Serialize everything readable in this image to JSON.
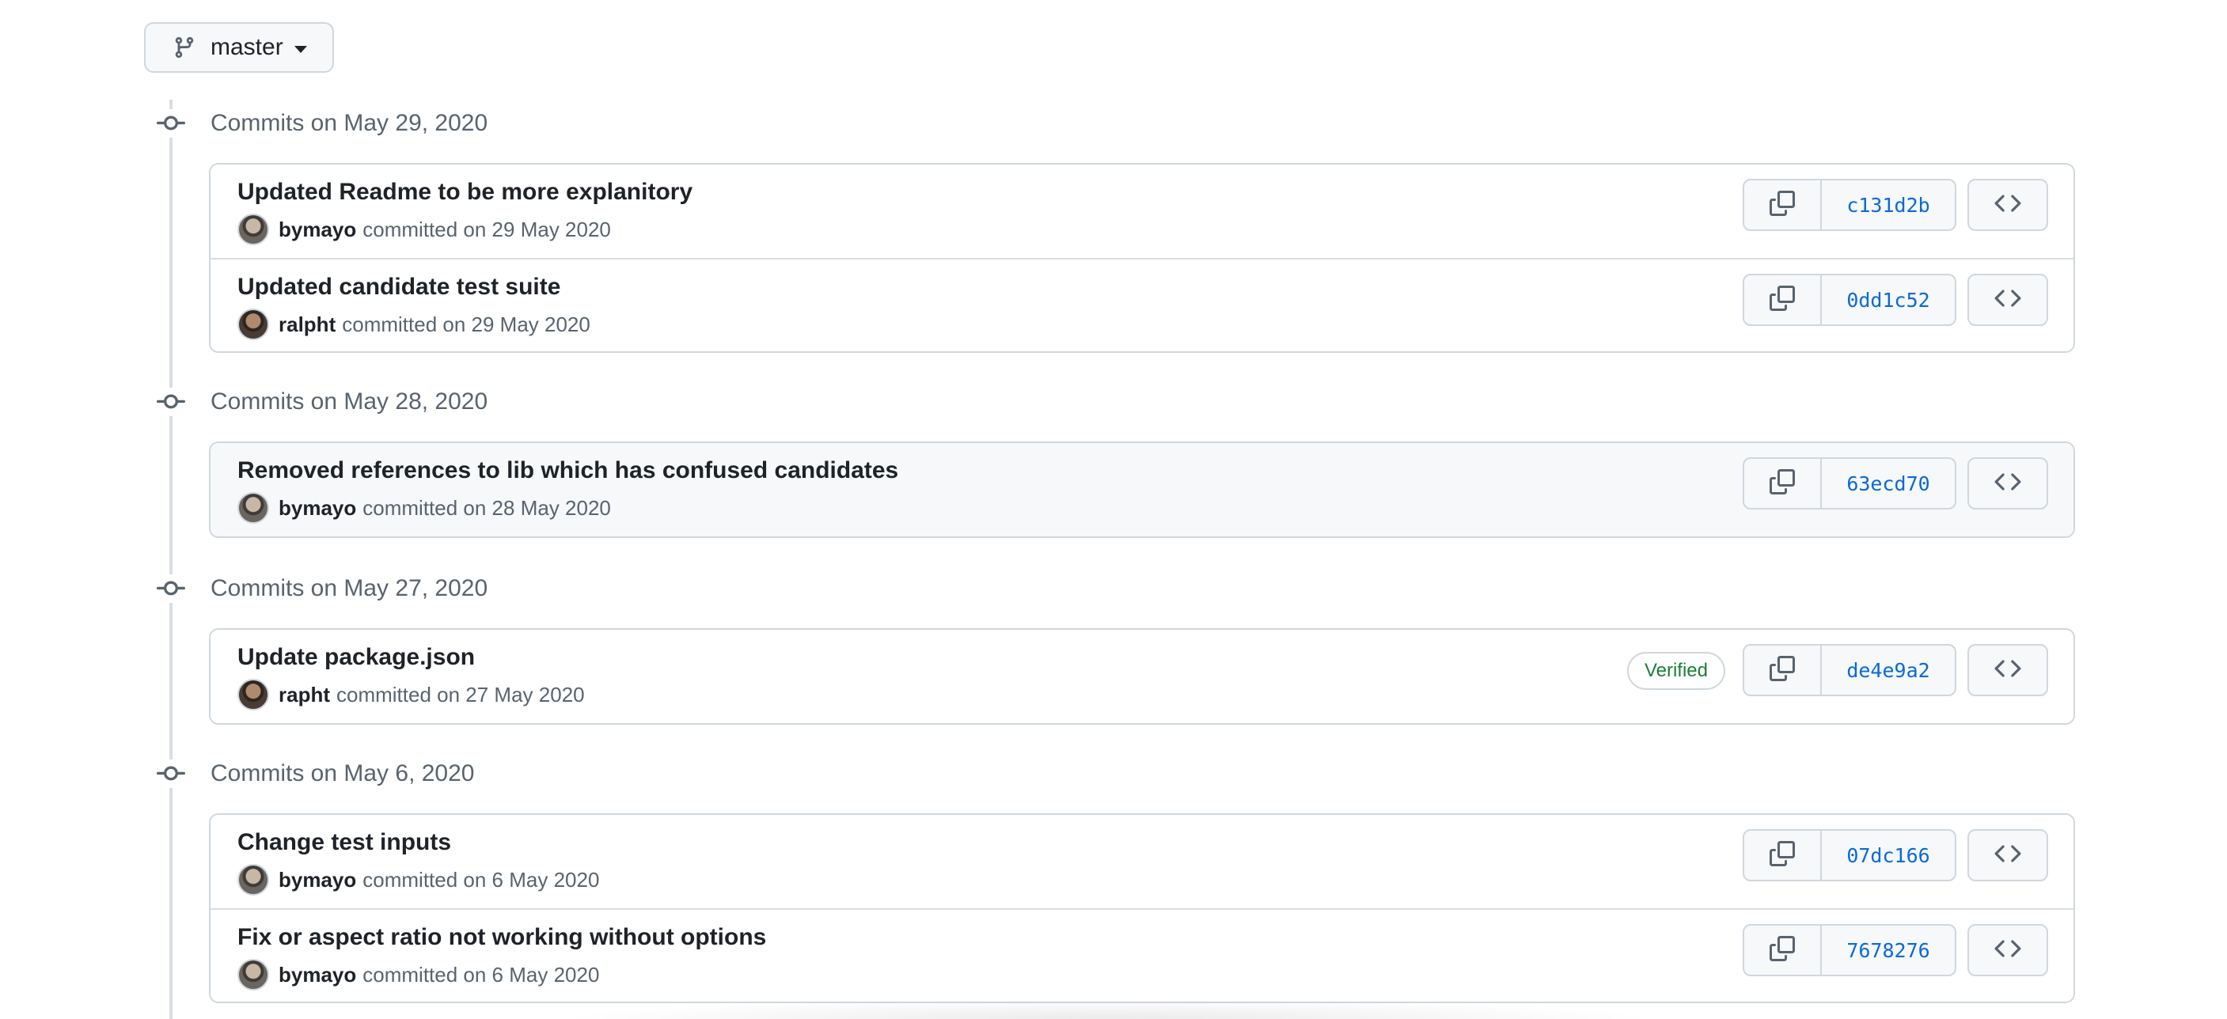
{
  "branch": {
    "label": "master",
    "icon": "git-branch-icon"
  },
  "groups": [
    {
      "title": "Commits on May 29, 2020",
      "commits": [
        {
          "title": "Updated Readme to be more explanitory",
          "author": "bymayo",
          "committed": "committed on 29 May 2020",
          "sha": "c131d2b",
          "verified": null
        },
        {
          "title": "Updated candidate test suite",
          "author": "ralpht",
          "committed": "committed on 29 May 2020",
          "sha": "0dd1c52",
          "verified": null
        }
      ]
    },
    {
      "title": "Commits on May 28, 2020",
      "commits": [
        {
          "title": "Removed references to lib which has confused candidates",
          "author": "bymayo",
          "committed": "committed on 28 May 2020",
          "sha": "63ecd70",
          "verified": null
        }
      ]
    },
    {
      "title": "Commits on May 27, 2020",
      "commits": [
        {
          "title": "Update package.json",
          "author": "rapht",
          "committed": "committed on 27 May 2020",
          "sha": "de4e9a2",
          "verified": "Verified"
        }
      ]
    },
    {
      "title": "Commits on May 6, 2020",
      "commits": [
        {
          "title": "Change test inputs",
          "author": "bymayo",
          "committed": "committed on 6 May 2020",
          "sha": "07dc166",
          "verified": null
        },
        {
          "title": "Fix or aspect ratio not working without options",
          "author": "bymayo",
          "committed": "committed on 6 May 2020",
          "sha": "7678276",
          "verified": null
        }
      ]
    }
  ],
  "colors": {
    "sha_link": "#0969da",
    "verified": "#1a7f37",
    "muted": "#59636e",
    "border": "#d0d7de"
  }
}
